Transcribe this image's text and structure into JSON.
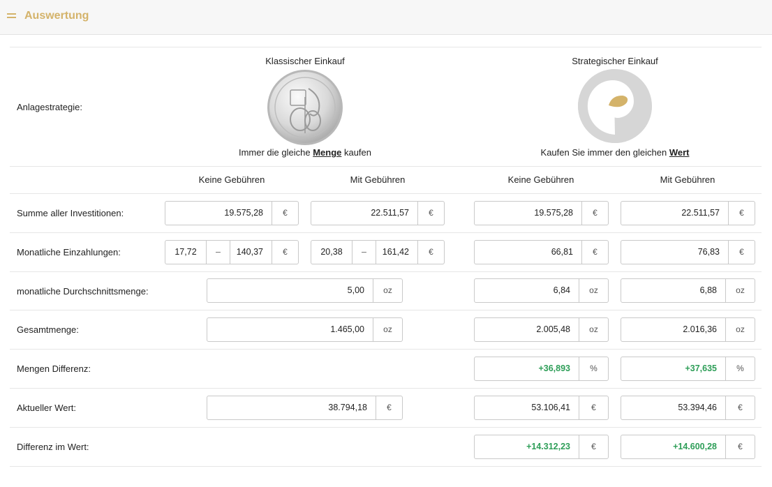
{
  "header": {
    "title": "Auswertung"
  },
  "strategy": {
    "row_label": "Anlagestrategie:",
    "classic": {
      "title": "Klassischer Einkauf",
      "sub_prefix": "Immer die gleiche ",
      "sub_bold": "Menge",
      "sub_suffix": " kaufen",
      "image": "silver-coin-icon"
    },
    "strategic": {
      "title": "Strategischer Einkauf",
      "sub_prefix": "Kaufen Sie immer den gleichen ",
      "sub_bold": "Wert",
      "image": "spiral-logo-icon"
    }
  },
  "column_headers": [
    "Keine Gebühren",
    "Mit Gebühren",
    "Keine Gebühren",
    "Mit Gebühren"
  ],
  "colors": {
    "accent": "#d4b36a",
    "positive": "#2e9e58"
  },
  "rows": {
    "summe": {
      "label": "Summe aller Investitionen:",
      "values": [
        "19.575,28",
        "22.511,57",
        "19.575,28",
        "22.511,57"
      ],
      "unit": "€"
    },
    "monatlich": {
      "label": "Monatliche Einzahlungen:",
      "c1": {
        "min": "17,72",
        "sep": "–",
        "max": "140,37"
      },
      "c2": {
        "min": "20,38",
        "sep": "–",
        "max": "161,42"
      },
      "values": [
        "66,81",
        "76,83"
      ],
      "unit": "€"
    },
    "durchschnitt": {
      "label": "monatliche Durchschnittsmenge:",
      "classic": "5,00",
      "values": [
        "6,84",
        "6,88"
      ],
      "unit": "oz"
    },
    "gesamtmenge": {
      "label": "Gesamtmenge:",
      "classic": "1.465,00",
      "values": [
        "2.005,48",
        "2.016,36"
      ],
      "unit": "oz"
    },
    "mengen_diff": {
      "label": "Mengen Differenz:",
      "values": [
        "+36,893",
        "+37,635"
      ],
      "unit": "%"
    },
    "wert": {
      "label": "Aktueller Wert:",
      "classic": "38.794,18",
      "values": [
        "53.106,41",
        "53.394,46"
      ],
      "unit": "€"
    },
    "wert_diff": {
      "label": "Differenz im Wert:",
      "values": [
        "+14.312,23",
        "+14.600,28"
      ],
      "unit": "€"
    }
  }
}
